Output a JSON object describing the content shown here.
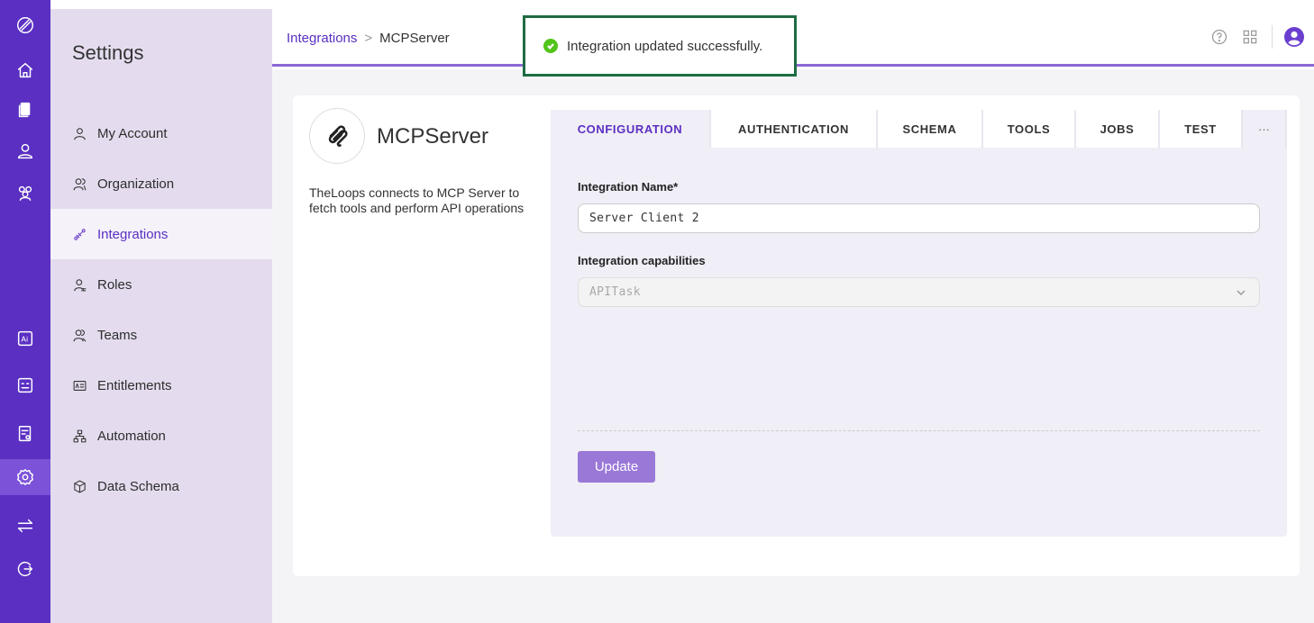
{
  "rail": {
    "items": [
      {
        "name": "logo-icon"
      },
      {
        "name": "home-icon"
      },
      {
        "name": "documents-icon"
      },
      {
        "name": "user-icon"
      },
      {
        "name": "group-icon"
      },
      {
        "name": "ai-icon"
      },
      {
        "name": "monitor-icon"
      },
      {
        "name": "report-icon"
      },
      {
        "name": "settings-icon",
        "active": true
      },
      {
        "name": "swap-icon"
      },
      {
        "name": "logout-icon"
      }
    ]
  },
  "settings": {
    "title": "Settings",
    "items": [
      {
        "label": "My Account",
        "icon": "user-icon"
      },
      {
        "label": "Organization",
        "icon": "group-icon"
      },
      {
        "label": "Integrations",
        "icon": "integration-icon",
        "active": true
      },
      {
        "label": "Roles",
        "icon": "role-icon"
      },
      {
        "label": "Teams",
        "icon": "teams-icon"
      },
      {
        "label": "Entitlements",
        "icon": "entitlements-icon"
      },
      {
        "label": "Automation",
        "icon": "automation-icon"
      },
      {
        "label": "Data Schema",
        "icon": "cube-icon"
      }
    ]
  },
  "breadcrumb": {
    "parent": "Integrations",
    "separator": ">",
    "current": "MCPServer"
  },
  "toast": {
    "message": "Integration updated successfully."
  },
  "integration": {
    "title": "MCPServer",
    "description": "TheLoops connects to MCP Server to fetch tools and perform API operations"
  },
  "tabs": [
    {
      "label": "CONFIGURATION",
      "active": true
    },
    {
      "label": "AUTHENTICATION"
    },
    {
      "label": "SCHEMA"
    },
    {
      "label": "TOOLS"
    },
    {
      "label": "JOBS"
    },
    {
      "label": "TEST"
    },
    {
      "label": "···"
    }
  ],
  "form": {
    "name_label": "Integration Name*",
    "name_value": "Server Client 2",
    "capabilities_label": "Integration capabilities",
    "capabilities_value": "APITask",
    "update_label": "Update"
  },
  "colors": {
    "brand": "#5a2fc2",
    "toast_border": "#1f6b43",
    "success": "#52c41a",
    "button": "#9a78d8"
  }
}
